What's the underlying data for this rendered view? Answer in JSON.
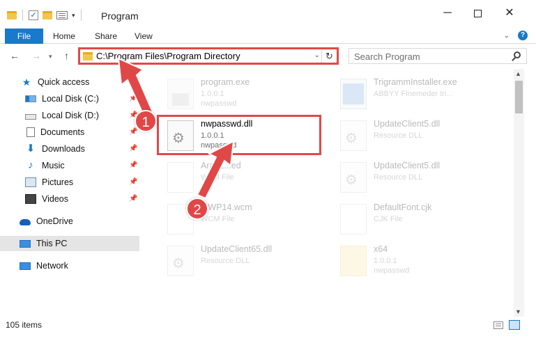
{
  "window": {
    "title": "Program",
    "minimize_icon": "minimize-icon",
    "maximize_icon": "maximize-icon",
    "close_icon": "close-icon"
  },
  "ribbon": {
    "file_tab": "File",
    "tabs": [
      "Home",
      "Share",
      "View"
    ],
    "help": "?"
  },
  "nav": {
    "address": "C:\\Program Files\\Program Directory",
    "search_placeholder": "Search Program"
  },
  "sidebar": {
    "items": [
      {
        "label": "Quick access",
        "icon": "star-icon",
        "pinned": false
      },
      {
        "label": "Local Disk (C:)",
        "icon": "drive-icon",
        "pinned": true
      },
      {
        "label": "Local Disk (D:)",
        "icon": "drive-icon",
        "pinned": true
      },
      {
        "label": "Documents",
        "icon": "documents-icon",
        "pinned": true
      },
      {
        "label": "Downloads",
        "icon": "download-icon",
        "pinned": true
      },
      {
        "label": "Music",
        "icon": "music-icon",
        "pinned": true
      },
      {
        "label": "Pictures",
        "icon": "pictures-icon",
        "pinned": true
      },
      {
        "label": "Videos",
        "icon": "videos-icon",
        "pinned": true
      },
      {
        "label": "OneDrive",
        "icon": "onedrive-icon",
        "pinned": false
      },
      {
        "label": "This PC",
        "icon": "pc-icon",
        "pinned": false,
        "selected": true
      },
      {
        "label": "Network",
        "icon": "network-icon",
        "pinned": false
      }
    ]
  },
  "files": [
    {
      "name": "program.exe",
      "line2": "1.0.0.1",
      "line3": "nwpasswd",
      "faded": true
    },
    {
      "name": "TrigrammInstaller.exe",
      "line2": "ABBYY Finemeder tri...",
      "line3": "",
      "faded": true
    },
    {
      "name": "nwpasswd.dll",
      "line2": "1.0.0.1",
      "line3": "nwpasswd",
      "faded": false
    },
    {
      "name": "UpdateClient5.dll",
      "line2": "Resource DLL",
      "line3": "",
      "faded": true
    },
    {
      "name": "AradL...ed",
      "line2": "WEM File",
      "line3": "",
      "faded": true
    },
    {
      "name": "UpdateClient5.dll",
      "line2": "Resource DLL",
      "line3": "",
      "faded": true
    },
    {
      "name": "...WP14.wcm",
      "line2": "WCM File",
      "line3": "",
      "faded": true
    },
    {
      "name": "DefaultFont.cjk",
      "line2": "CJK File",
      "line3": "",
      "faded": true
    },
    {
      "name": "UpdateClient65.dll",
      "line2": "Resource DLL",
      "line3": "",
      "faded": true
    },
    {
      "name": "x64",
      "line2": "1.0.0.1",
      "line3": "nwpasswd",
      "faded": true
    }
  ],
  "status": {
    "items_count": "105 items"
  },
  "callouts": [
    "1",
    "2"
  ],
  "colors": {
    "accent": "#1979ca",
    "highlight": "#e04848"
  }
}
